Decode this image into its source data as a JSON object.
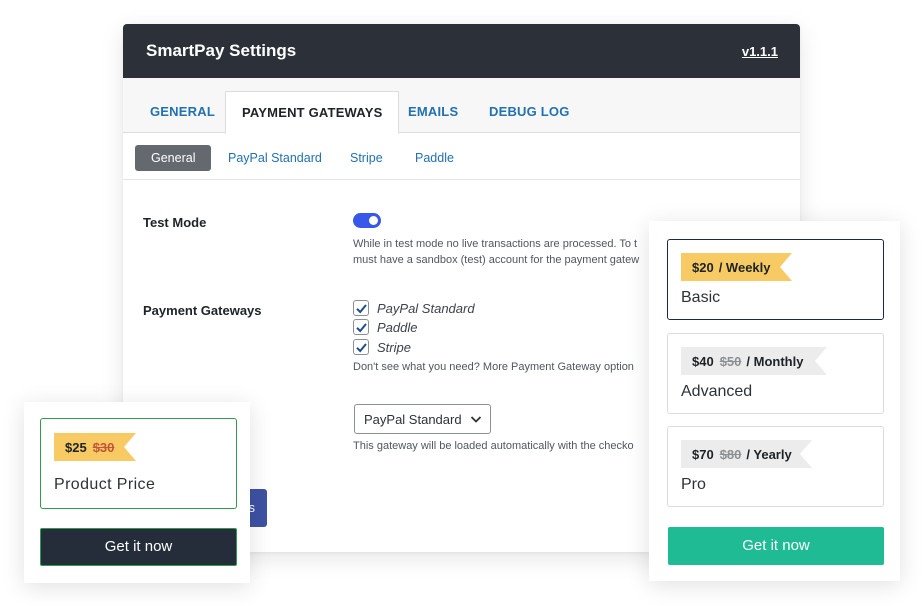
{
  "header": {
    "title": "SmartPay Settings",
    "version": "v1.1.1"
  },
  "tabs": [
    {
      "label": "General",
      "active": false
    },
    {
      "label": "Payment Gateways",
      "active": true
    },
    {
      "label": "Emails",
      "active": false
    },
    {
      "label": "Debug Log",
      "active": false
    }
  ],
  "subtabs": [
    {
      "label": "General",
      "active": true
    },
    {
      "label": "PayPal Standard",
      "active": false
    },
    {
      "label": "Stripe",
      "active": false
    },
    {
      "label": "Paddle",
      "active": false
    }
  ],
  "settings": {
    "test_mode": {
      "label": "Test Mode",
      "enabled": true,
      "help_line1": "While in test mode no live transactions are processed. To t",
      "help_line2": "must have a sandbox (test) account for the payment gatew"
    },
    "payment_gateways": {
      "label": "Payment Gateways",
      "options": [
        {
          "label": "PayPal Standard",
          "checked": true
        },
        {
          "label": "Paddle",
          "checked": true
        },
        {
          "label": "Stripe",
          "checked": true
        }
      ],
      "help": "Don't see what you need? More Payment Gateway option"
    },
    "default_gateway": {
      "selected": "PayPal Standard",
      "help": "This gateway will be loaded automatically with the checko"
    },
    "save_button_label": "s"
  },
  "product_card": {
    "price": "$25",
    "original_price": "$30",
    "name": "Product Price",
    "button_label": "Get it now"
  },
  "pricing_card": {
    "plans": [
      {
        "price": "$20",
        "original_price": "",
        "period": "/ Weekly",
        "name": "Basic",
        "selected": true
      },
      {
        "price": "$40",
        "original_price": "$50",
        "period": "/ Monthly",
        "name": "Advanced",
        "selected": false
      },
      {
        "price": "$70",
        "original_price": "$80",
        "period": "/ Yearly",
        "name": "Pro",
        "selected": false
      }
    ],
    "button_label": "Get it now"
  },
  "colors": {
    "header_bg": "#2c3038",
    "tab_link": "#2271b1",
    "toggle_on": "#3858e9",
    "ribbon_yellow": "#f8ca63",
    "ribbon_gray": "#ececec",
    "dark_button": "#252d3b",
    "teal_button": "#1fbb94",
    "green_border": "#2e9b4e"
  }
}
